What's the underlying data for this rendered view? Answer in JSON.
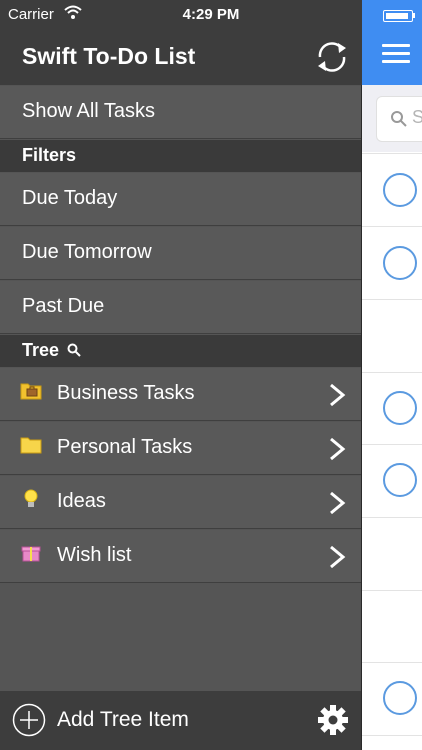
{
  "status_bar": {
    "carrier": "Carrier",
    "time": "4:29 PM"
  },
  "drawer": {
    "title": "Swift To-Do List",
    "show_all": "Show All Tasks",
    "filters_header": "Filters",
    "filters": [
      "Due Today",
      "Due Tomorrow",
      "Past Due"
    ],
    "tree_header": "Tree",
    "tree_items": [
      {
        "label": "Business Tasks",
        "icon": "briefcase-folder-icon"
      },
      {
        "label": "Personal Tasks",
        "icon": "folder-icon"
      },
      {
        "label": "Ideas",
        "icon": "lightbulb-icon"
      },
      {
        "label": "Wish list",
        "icon": "gift-icon"
      }
    ],
    "add_tree_item": "Add Tree Item"
  },
  "main": {
    "search_placeholder": "S"
  },
  "colors": {
    "accent": "#3f8df2",
    "drawer_bg": "#555555",
    "header_bg": "#3d3d3d",
    "circle": "#5b9ae0"
  }
}
